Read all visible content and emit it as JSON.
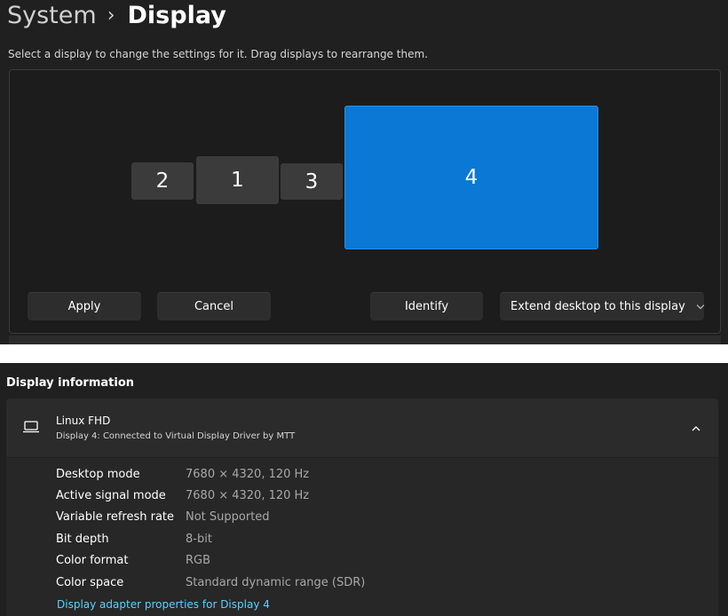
{
  "header": {
    "breadcrumb_parent": "System",
    "separator": "›",
    "page_title": "Display"
  },
  "arrangement": {
    "instructions": "Select a display to change the settings for it. Drag displays to rearrange them.",
    "monitors": [
      {
        "label": "2",
        "selected": false
      },
      {
        "label": "1",
        "selected": false
      },
      {
        "label": "3",
        "selected": false
      },
      {
        "label": "4",
        "selected": true
      }
    ],
    "apply_label": "Apply",
    "cancel_label": "Cancel",
    "identify_label": "Identify",
    "mode_dropdown_value": "Extend desktop to this display"
  },
  "display_information": {
    "section_title": "Display information",
    "card": {
      "icon": "laptop-icon",
      "name": "Linux FHD",
      "subtitle": "Display 4: Connected to Virtual Display Driver by MTT",
      "collapse_icon": "chevron-up-icon"
    },
    "rows": [
      {
        "label": "Desktop mode",
        "value": "7680 × 4320, 120 Hz"
      },
      {
        "label": "Active signal mode",
        "value": "7680 × 4320, 120 Hz"
      },
      {
        "label": "Variable refresh rate",
        "value": "Not Supported"
      },
      {
        "label": "Bit depth",
        "value": "8-bit"
      },
      {
        "label": "Color format",
        "value": "RGB"
      },
      {
        "label": "Color space",
        "value": "Standard dynamic range (SDR)"
      }
    ],
    "adapter_link": "Display adapter properties for Display 4"
  },
  "colors": {
    "background": "#202020",
    "selected_monitor": "#0a78d4",
    "link": "#60cdff"
  }
}
